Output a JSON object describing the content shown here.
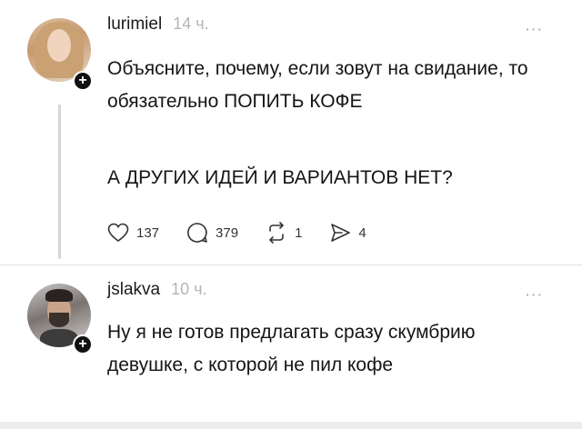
{
  "posts": [
    {
      "username": "lurimiel",
      "time": "14 ч.",
      "paragraphs": [
        "Объясните, почему, если зовут на свидание, то обязательно ПОПИТЬ КОФЕ",
        "А ДРУГИХ ИДЕЙ И ВАРИАНТОВ НЕТ?"
      ],
      "actions": {
        "likes": "137",
        "comments": "379",
        "reposts": "1",
        "shares": "4"
      },
      "icons": [
        "heart-icon",
        "comment-icon",
        "repost-icon",
        "share-icon"
      ]
    },
    {
      "username": "jslakva",
      "time": "10 ч.",
      "paragraphs": [
        "Ну я не готов предлагать сразу скумбрию девушке, с которой не пил кофе"
      ]
    }
  ],
  "more_label": "···",
  "plus_label": "+"
}
